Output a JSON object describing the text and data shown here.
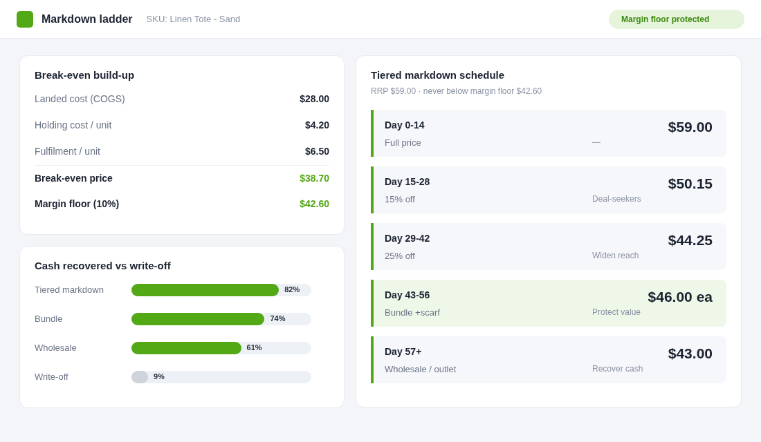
{
  "header": {
    "title": "Markdown ladder",
    "subtitle": "SKU: Linen Tote - Sand",
    "status_badge": "Margin floor protected"
  },
  "breakeven": {
    "title": "Break-even build-up",
    "rows": [
      {
        "kind": "line",
        "label": "Landed cost (COGS)",
        "value": "$28.00"
      },
      {
        "kind": "line",
        "label": "Holding cost / unit",
        "value": "$4.20"
      },
      {
        "kind": "line",
        "label": "Fulfilment / unit",
        "value": "$6.50"
      },
      {
        "kind": "total",
        "label": "Break-even price",
        "value": "$38.70"
      },
      {
        "kind": "total",
        "label": "Margin floor (10%)",
        "value": "$42.60"
      }
    ]
  },
  "cash_recovered": {
    "title": "Cash recovered vs write-off",
    "bars": [
      {
        "label": "Tiered markdown",
        "level": 0.82,
        "reading": "82%",
        "color": "#52a815"
      },
      {
        "label": "Bundle",
        "level": 0.74,
        "reading": "74%",
        "color": "#52a815"
      },
      {
        "label": "Wholesale",
        "level": 0.61,
        "reading": "61%",
        "color": "#52a815"
      },
      {
        "label": "Write-off",
        "level": 0.09,
        "reading": "9%",
        "color": "#cfd4dc"
      }
    ]
  },
  "schedule": {
    "title": "Tiered markdown schedule",
    "subtitle": "RRP $59.00 · never below margin floor $42.60",
    "tiers": [
      {
        "days": "Day 0-14",
        "action": "Full price",
        "note": "—",
        "price": "$59.00",
        "highlighted": false
      },
      {
        "days": "Day 15-28",
        "action": "15% off",
        "note": "Deal-seekers",
        "price": "$50.15",
        "highlighted": false
      },
      {
        "days": "Day 29-42",
        "action": "25% off",
        "note": "Widen reach",
        "price": "$44.25",
        "highlighted": false
      },
      {
        "days": "Day 43-56",
        "action": "Bundle +scarf",
        "note": "Protect value",
        "price": "$46.00 ea",
        "highlighted": true
      },
      {
        "days": "Day 57+",
        "action": "Wholesale / outlet",
        "note": "Recover cash",
        "price": "$43.00",
        "highlighted": false
      }
    ]
  }
}
